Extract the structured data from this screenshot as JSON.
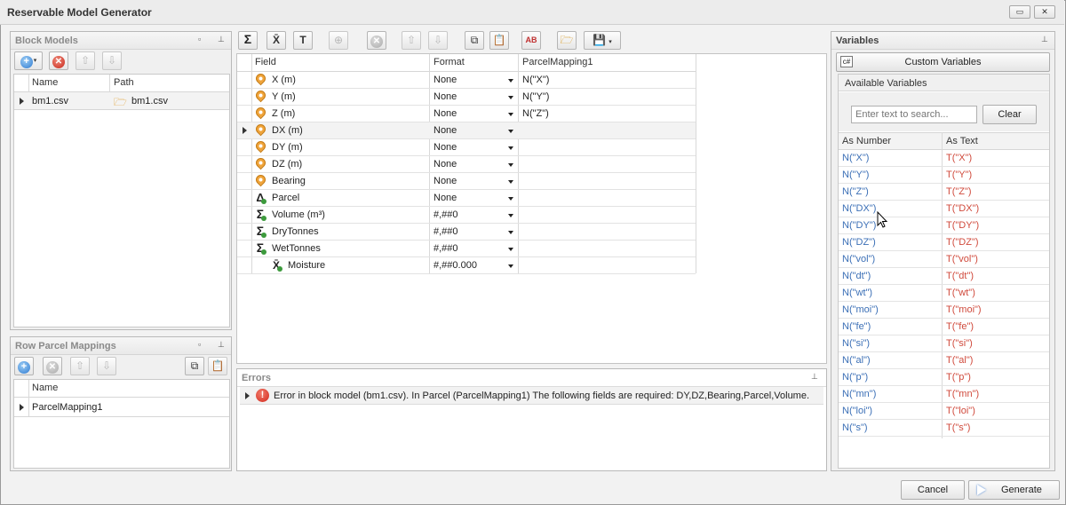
{
  "window": {
    "title": "Reservable Model Generator"
  },
  "block_models": {
    "title": "Block Models",
    "columns": [
      "Name",
      "Path"
    ],
    "rows": [
      {
        "name": "bm1.csv",
        "path": "bm1.csv"
      }
    ]
  },
  "parcel_mappings": {
    "title": "Row Parcel Mappings",
    "columns": [
      "Name"
    ],
    "rows": [
      {
        "name": "ParcelMapping1"
      }
    ]
  },
  "field_grid": {
    "columns": [
      "Field",
      "Format",
      "ParcelMapping1"
    ],
    "rows": [
      {
        "icon": "location-icon",
        "field": "X (m)",
        "format": "None",
        "mapping": "N(\"X\")"
      },
      {
        "icon": "location-icon",
        "field": "Y (m)",
        "format": "None",
        "mapping": "N(\"Y\")"
      },
      {
        "icon": "location-icon",
        "field": "Z (m)",
        "format": "None",
        "mapping": "N(\"Z\")"
      },
      {
        "icon": "location-icon",
        "field": "DX (m)",
        "format": "None",
        "mapping": ""
      },
      {
        "icon": "location-icon",
        "field": "DY (m)",
        "format": "None",
        "mapping": ""
      },
      {
        "icon": "location-icon",
        "field": "DZ (m)",
        "format": "None",
        "mapping": ""
      },
      {
        "icon": "location-icon",
        "field": "Bearing",
        "format": "None",
        "mapping": ""
      },
      {
        "icon": "delta-icon",
        "field": "Parcel",
        "format": "None",
        "mapping": ""
      },
      {
        "icon": "sum-icon",
        "field": "Volume (m³)",
        "format": "#,##0",
        "mapping": ""
      },
      {
        "icon": "sum-icon",
        "field": "DryTonnes",
        "format": "#,##0",
        "mapping": ""
      },
      {
        "icon": "sum-icon",
        "field": "WetTonnes",
        "format": "#,##0",
        "mapping": ""
      },
      {
        "icon": "mean-icon",
        "field": "Moisture",
        "format": "#,##0.000",
        "mapping": ""
      }
    ]
  },
  "errors": {
    "title": "Errors",
    "message": "Error in block model (bm1.csv). In Parcel (ParcelMapping1) The following fields are required: DY,DZ,Bearing,Parcel,Volume."
  },
  "variables": {
    "title": "Variables",
    "custom_button": "Custom Variables",
    "custom_icon_text": "c#",
    "available_title": "Available Variables",
    "search_placeholder": "Enter text to search...",
    "clear_label": "Clear",
    "columns": [
      "As Number",
      "As Text"
    ],
    "rows": [
      {
        "num": "N(\"X\")",
        "text": "T(\"X\")"
      },
      {
        "num": "N(\"Y\")",
        "text": "T(\"Y\")"
      },
      {
        "num": "N(\"Z\")",
        "text": "T(\"Z\")"
      },
      {
        "num": "N(\"DX\")",
        "text": "T(\"DX\")"
      },
      {
        "num": "N(\"DY\")",
        "text": "T(\"DY\")"
      },
      {
        "num": "N(\"DZ\")",
        "text": "T(\"DZ\")"
      },
      {
        "num": "N(\"vol\")",
        "text": "T(\"vol\")"
      },
      {
        "num": "N(\"dt\")",
        "text": "T(\"dt\")"
      },
      {
        "num": "N(\"wt\")",
        "text": "T(\"wt\")"
      },
      {
        "num": "N(\"moi\")",
        "text": "T(\"moi\")"
      },
      {
        "num": "N(\"fe\")",
        "text": "T(\"fe\")"
      },
      {
        "num": "N(\"si\")",
        "text": "T(\"si\")"
      },
      {
        "num": "N(\"al\")",
        "text": "T(\"al\")"
      },
      {
        "num": "N(\"p\")",
        "text": "T(\"p\")"
      },
      {
        "num": "N(\"mn\")",
        "text": "T(\"mn\")"
      },
      {
        "num": "N(\"loi\")",
        "text": "T(\"loi\")"
      },
      {
        "num": "N(\"s\")",
        "text": "T(\"s\")"
      }
    ]
  },
  "footer": {
    "cancel_label": "Cancel",
    "generate_label": "Generate"
  },
  "colors": {
    "number_blue": "#3b6fb6",
    "text_red": "#d04a3c",
    "error_red": "#d42a1e"
  }
}
